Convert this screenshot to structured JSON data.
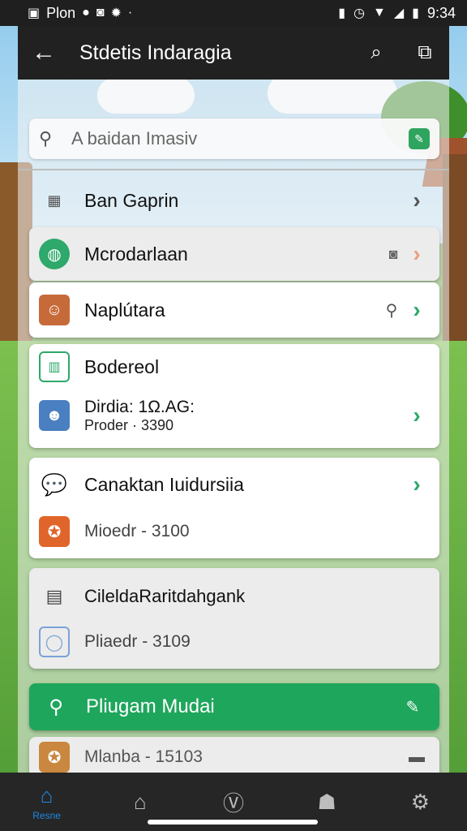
{
  "status_bar": {
    "left_text": "Plon",
    "time": "9:34",
    "icons": [
      "image-icon",
      "notification-icon",
      "instagram-icon",
      "bug-icon",
      "vibrate-icon",
      "alarm-icon",
      "wifi-icon",
      "signal-icon",
      "battery-icon"
    ]
  },
  "toolbar": {
    "title": "Stdetis Indaragia",
    "back_icon": "arrow-left-icon",
    "search_icon": "search-icon",
    "share_icon": "share-icon"
  },
  "search": {
    "placeholder": "A baidan Imasiv"
  },
  "rows": {
    "row1": {
      "label": "Ban Gaprin"
    },
    "row2": {
      "label": "Mcrodarlaan"
    },
    "row3": {
      "label": "Naplútara"
    },
    "card1": {
      "title": "Bodereol",
      "line1": "Dirdia: 1Ω.AG:",
      "line2": "Proder · 3390"
    },
    "card2": {
      "title": "Canaktan Iuidursiia",
      "sub": "Mioedr - 3100"
    },
    "card3": {
      "title": "CileldaRaritdahgank",
      "sub": "Pliaedr - 3109"
    }
  },
  "green_button": {
    "label": "Pliugam Mudai"
  },
  "bottom_item": {
    "label": "Mlanba - 15103"
  },
  "nav": {
    "items": [
      {
        "label": "Resne",
        "icon": "home-icon"
      },
      {
        "label": "",
        "icon": "house-icon"
      },
      {
        "label": "",
        "icon": "v-circle-icon"
      },
      {
        "label": "",
        "icon": "person-icon"
      },
      {
        "label": "",
        "icon": "gear-icon"
      }
    ]
  },
  "colors": {
    "accent_green": "#1fa65d",
    "chevron_green": "#2ea86b",
    "toolbar_dark": "#212121",
    "nav_active_blue": "#1e88e5"
  }
}
